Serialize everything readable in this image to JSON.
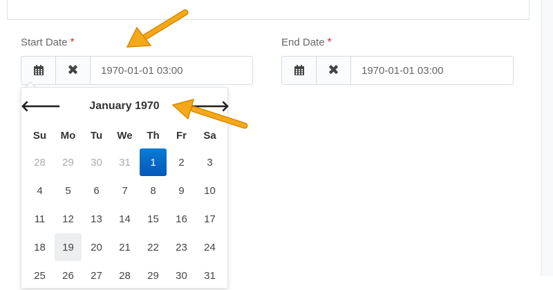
{
  "start": {
    "label": "Start Date",
    "required_mark": "*",
    "value": "1970-01-01 03:00",
    "calendar_icon": "calendar-icon",
    "clear_icon": "close-icon"
  },
  "end": {
    "label": "End Date",
    "required_mark": "*",
    "value": "1970-01-01 03:00",
    "calendar_icon": "calendar-icon",
    "clear_icon": "close-icon"
  },
  "picker": {
    "title": "January 1970",
    "prev_icon": "arrow-left-icon",
    "next_icon": "arrow-right-icon",
    "weekdays": [
      "Su",
      "Mo",
      "Tu",
      "We",
      "Th",
      "Fr",
      "Sa"
    ],
    "weeks": [
      [
        {
          "d": "28",
          "old": true
        },
        {
          "d": "29",
          "old": true
        },
        {
          "d": "30",
          "old": true
        },
        {
          "d": "31",
          "old": true
        },
        {
          "d": "1",
          "active": true
        },
        {
          "d": "2"
        },
        {
          "d": "3"
        }
      ],
      [
        {
          "d": "4"
        },
        {
          "d": "5"
        },
        {
          "d": "6"
        },
        {
          "d": "7"
        },
        {
          "d": "8"
        },
        {
          "d": "9"
        },
        {
          "d": "10"
        }
      ],
      [
        {
          "d": "11"
        },
        {
          "d": "12"
        },
        {
          "d": "13"
        },
        {
          "d": "14"
        },
        {
          "d": "15"
        },
        {
          "d": "16"
        },
        {
          "d": "17"
        }
      ],
      [
        {
          "d": "18"
        },
        {
          "d": "19",
          "today": true
        },
        {
          "d": "20"
        },
        {
          "d": "21"
        },
        {
          "d": "22"
        },
        {
          "d": "23"
        },
        {
          "d": "24"
        }
      ],
      [
        {
          "d": "25"
        },
        {
          "d": "26"
        },
        {
          "d": "27"
        },
        {
          "d": "28"
        },
        {
          "d": "29"
        },
        {
          "d": "30"
        },
        {
          "d": "31"
        }
      ]
    ]
  },
  "colors": {
    "annotation_arrow": "#f2a20c",
    "active_day": "#0a6fcf",
    "required": "#e32626"
  }
}
